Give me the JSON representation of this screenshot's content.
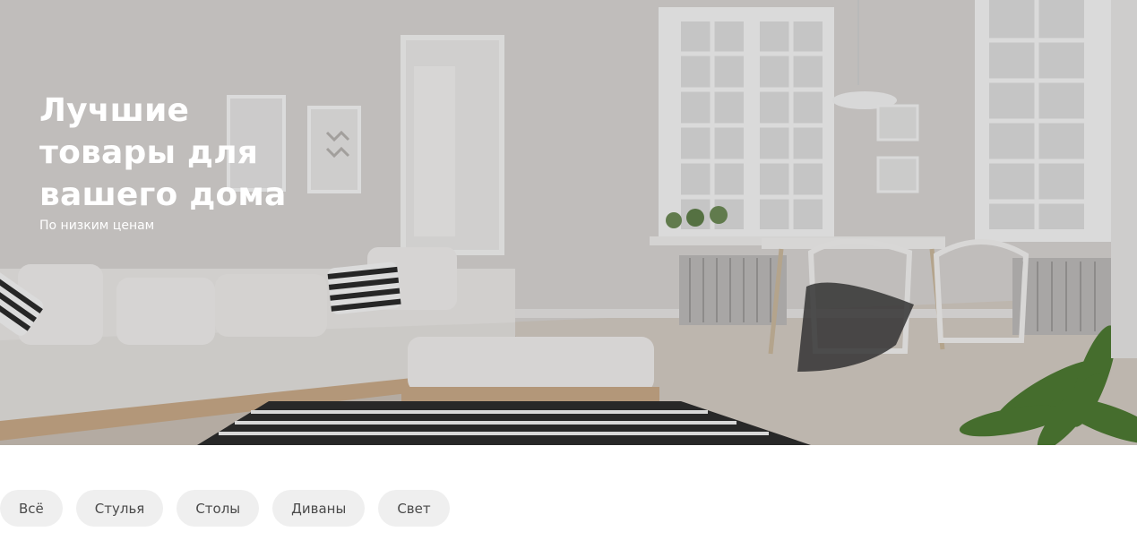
{
  "hero": {
    "title": "Лучшие\nтовары для\nвашего дома",
    "subtitle": "По низким ценам"
  },
  "filters": [
    {
      "label": "Всё"
    },
    {
      "label": "Стулья"
    },
    {
      "label": "Столы"
    },
    {
      "label": "Диваны"
    },
    {
      "label": "Свет"
    }
  ],
  "colors": {
    "chip_bg": "#efefef",
    "chip_text": "#4a4a4a",
    "hero_text": "#ffffff"
  }
}
